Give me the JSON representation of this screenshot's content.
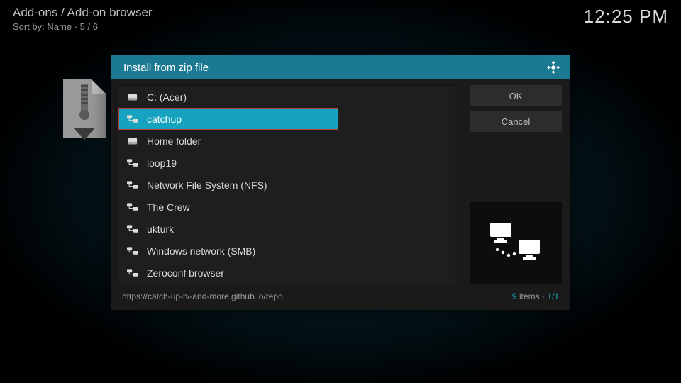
{
  "header": {
    "breadcrumbs": "Add-ons / Add-on browser",
    "sort_line": "Sort by: Name  ·  5 / 6",
    "clock": "12:25 PM"
  },
  "dialog": {
    "title": "Install from zip file",
    "buttons": {
      "ok": "OK",
      "cancel": "Cancel"
    },
    "items": [
      {
        "label": "C: (Acer)",
        "icon": "drive"
      },
      {
        "label": "catchup",
        "icon": "net",
        "selected": true
      },
      {
        "label": "Home folder",
        "icon": "drive"
      },
      {
        "label": "loop19",
        "icon": "net"
      },
      {
        "label": "Network File System (NFS)",
        "icon": "net"
      },
      {
        "label": "The Crew",
        "icon": "net"
      },
      {
        "label": "ukturk",
        "icon": "net"
      },
      {
        "label": "Windows network (SMB)",
        "icon": "net"
      },
      {
        "label": "Zeroconf browser",
        "icon": "net"
      }
    ],
    "footer": {
      "path": "https://catch-up-tv-and-more.github.io/repo",
      "count_num": "9",
      "count_label": " items · ",
      "page": "1/1"
    }
  }
}
